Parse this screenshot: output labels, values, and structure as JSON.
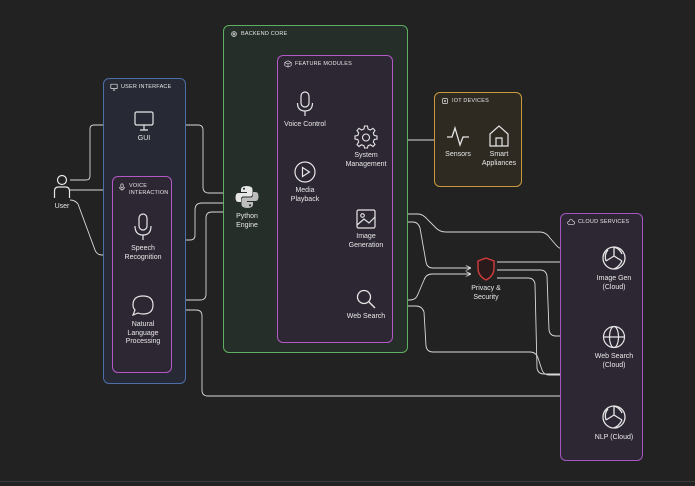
{
  "groups": {
    "user_interface": "USER INTERFACE",
    "voice_interaction": "VOICE\nINTERACTION",
    "backend_core": "BACKEND CORE",
    "feature_modules": "FEATURE MODULES",
    "iot_devices": "IOT DEVICES",
    "cloud_services": "CLOUD SERVICES"
  },
  "nodes": {
    "user": "User",
    "gui": "GUI",
    "speech": "Speech\nRecognition",
    "nlp": "Natural\nLanguage\nProcessing",
    "python": "Python\nEngine",
    "voice_control": "Voice Control",
    "media": "Media\nPlayback",
    "system": "System\nManagement",
    "image_gen": "Image\nGeneration",
    "web_search": "Web Search",
    "sensors": "Sensors",
    "smart": "Smart\nAppliances",
    "privacy": "Privacy &\nSecurity",
    "cloud_image": "Image Gen\n(Cloud)",
    "cloud_web": "Web Search\n(Cloud)",
    "cloud_nlp": "NLP (Cloud)"
  },
  "colors": {
    "background": "#222222",
    "ui_border": "#4d6fa8",
    "voice_border": "#b458c8",
    "backend_border": "#5fae62",
    "feature_border": "#b458c8",
    "iot_border": "#c99a3c",
    "cloud_border": "#a457c2",
    "privacy_red": "#d33c3c",
    "wire": "#d9d9d9"
  }
}
